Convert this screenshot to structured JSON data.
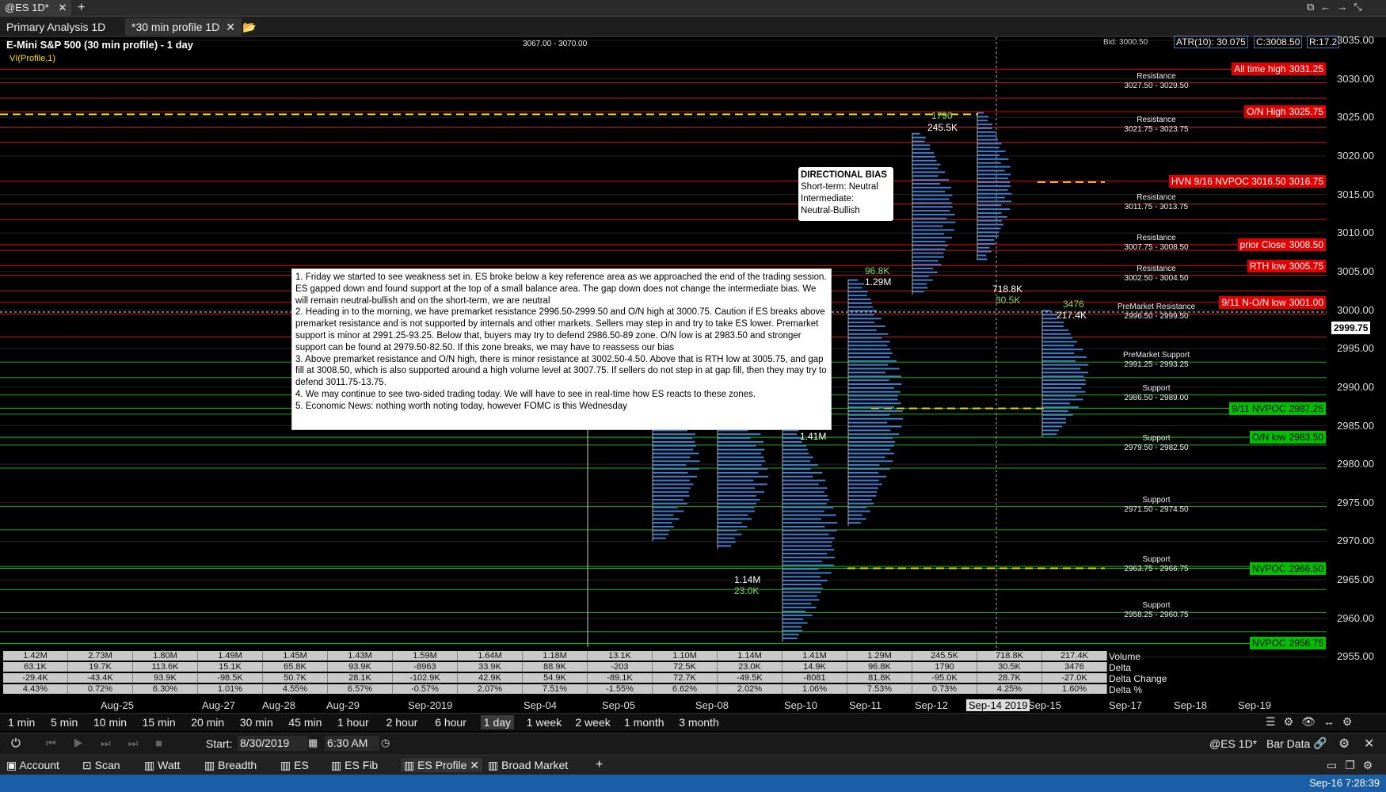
{
  "window_tabs": {
    "active": "@ES 1D*",
    "add": "+"
  },
  "chart_tabs": [
    {
      "label": "Primary Analysis 1D"
    },
    {
      "label": "*30 min profile 1D"
    }
  ],
  "chart": {
    "title": "E-Mini S&P 500 (30 min profile) - 1 day",
    "indicator": "VI(Profile,1)",
    "top_label": "3067.00 - 3070.00",
    "header_stats": {
      "atr": "ATR(10): 30.075",
      "close": "C:3008.50",
      "range": "R:17.2",
      "bid": "Bid: 3000.50"
    },
    "price_axis": [
      "3035.00",
      "3030.00",
      "3025.00",
      "3020.00",
      "3015.00",
      "3010.00",
      "3005.00",
      "3000.00",
      "2995.00",
      "2990.00",
      "2985.00",
      "2980.00",
      "2975.00",
      "2970.00",
      "2965.00",
      "2960.00",
      "2955.00"
    ],
    "current_price": "2999.75",
    "zones": [
      {
        "type": "Resistance",
        "range": "3027.50 - 3029.50"
      },
      {
        "type": "Resistance",
        "range": "3021.75 - 3023.75"
      },
      {
        "type": "Resistance",
        "range": "3011.75 - 3013.75"
      },
      {
        "type": "Resistance",
        "range": "3007.75 - 3008.50"
      },
      {
        "type": "Resistance",
        "range": "3002.50 - 3004.50"
      },
      {
        "type": "PreMarket Resistance",
        "range": "2996.50 - 2999.50"
      },
      {
        "type": "PreMarket Support",
        "range": "2991.25 - 2993.25"
      },
      {
        "type": "Support",
        "range": "2986.50 - 2989.00"
      },
      {
        "type": "Support",
        "range": "2979.50 - 2982.50"
      },
      {
        "type": "Support",
        "range": "2971.50 - 2974.50"
      },
      {
        "type": "Support",
        "range": "2963.75 - 2966.75"
      },
      {
        "type": "Support",
        "range": "2958.25 - 2960.75"
      }
    ],
    "tags": [
      {
        "label": "All time high",
        "price": "3031.25",
        "color": "red"
      },
      {
        "label": "O/N High",
        "price": "3025.75",
        "color": "red"
      },
      {
        "label": "HVN 9/16 NVPOC 3016.50",
        "price": "3016.75",
        "color": "red"
      },
      {
        "label": "prior Close",
        "price": "3008.50",
        "color": "red"
      },
      {
        "label": "RTH low",
        "price": "3005.75",
        "color": "red"
      },
      {
        "label": "9/11 N-O/N low",
        "price": "3001.00",
        "color": "red"
      },
      {
        "label": "9/11 NVPOC",
        "price": "2987.25",
        "color": "green"
      },
      {
        "label": "O/N low",
        "price": "2983.50",
        "color": "green"
      },
      {
        "label": "NVPOC",
        "price": "2966.50",
        "color": "green"
      },
      {
        "label": "NVPOC",
        "price": "2956.75",
        "color": "green"
      }
    ],
    "profile_labels": [
      {
        "vol": "1790",
        "vol2": "245.5K"
      },
      {
        "vol": "96.8K",
        "vol2": "1.29M"
      },
      {
        "vol": "718.8K",
        "vol2": "30.5K"
      },
      {
        "vol": "3476",
        "vol2": "217.4K"
      },
      {
        "vol": "1.14M",
        "vol2": "23.0K"
      },
      {
        "vol": "1.41M"
      }
    ],
    "bias": {
      "title": "DIRECTIONAL BIAS",
      "line1": "Short-term: Neutral",
      "line2": "Intermediate:",
      "line3": "Neutral-Bullish"
    },
    "notes": [
      "1. Friday we started to see weakness set in.  ES broke below a key reference area as we approached the end of the trading session.  ES gapped down and found support at the top of a small balance area.   The gap down does not change the intermediate bias.  We will remain neutral-bullish and on the short-term, we are neutral",
      "2. Heading in to the morning, we have premarket resistance 2996.50-2999.50 and O/N high at 3000.75.  Caution if ES breaks above premarket resistance and is not supported by internals and other markets.  Sellers may step in and try to take ES lower.  Premarket support is minor at 2991.25-93.25.  Below that, buyers may try to defend 2986.50-89 zone.  O/N low is at 2983.50 and stronger support can be found at 2979.50-82.50.  If this zone breaks, we may have to reassess our bias",
      "3. Above premarket resistance and O/N high, there is minor resistance at 3002.50-4.50.  Above that is RTH low at 3005.75, and gap fill at 3008.50, which is also supported around a high volume level at 3007.75.  If sellers do not step in at gap fill, then they may try to defend 3011.75-13.75.",
      "4. We may continue to see two-sided trading today.  We will have to see in real-time how ES reacts to these zones.",
      "5.  Economic News: nothing worth noting today, however FOMC is this Wednesday"
    ],
    "stats": {
      "labels": [
        "Volume",
        "Delta",
        "Delta Change",
        "Delta %"
      ],
      "volume": [
        "1.42M",
        "2.73M",
        "1.80M",
        "1.49M",
        "1.45M",
        "1.43M",
        "1.59M",
        "1.64M",
        "1.18M",
        "13.1K",
        "1.10M",
        "1.14M",
        "1.41M",
        "1.29M",
        "245.5K",
        "718.8K",
        "217.4K"
      ],
      "delta": [
        "63.1K",
        "19.7K",
        "113.6K",
        "15.1K",
        "65.8K",
        "93.9K",
        "-8963",
        "33.9K",
        "88.9K",
        "-203",
        "72.5K",
        "23.0K",
        "14.9K",
        "96.8K",
        "1790",
        "30.5K",
        "3476"
      ],
      "delta_change": [
        "-29.4K",
        "-43.4K",
        "93.9K",
        "-98.5K",
        "50.7K",
        "28.1K",
        "-102.9K",
        "42.9K",
        "54.9K",
        "-89.1K",
        "72.7K",
        "-49.5K",
        "-8081",
        "81.8K",
        "-95.0K",
        "28.7K",
        "-27.0K"
      ],
      "delta_pct": [
        "4.43%",
        "0.72%",
        "6.30%",
        "1.01%",
        "4.55%",
        "6.57%",
        "-0.57%",
        "2.07%",
        "7.51%",
        "-1.55%",
        "6.62%",
        "2.02%",
        "1.06%",
        "7.53%",
        "0.73%",
        "4.25%",
        "1.60%"
      ]
    },
    "dates": [
      "Aug-25",
      "Aug-27",
      "Aug-28",
      "Aug-29",
      "Sep-2019",
      "Sep-04",
      "Sep-05",
      "Sep-08",
      "Sep-10",
      "Sep-11",
      "Sep-12",
      "Sep-14 2019",
      "Sep-15",
      "Sep-17",
      "Sep-18",
      "Sep-19"
    ]
  },
  "timeframes": [
    "1 min",
    "5 min",
    "10 min",
    "15 min",
    "20 min",
    "30 min",
    "45 min",
    "1 hour",
    "2 hour",
    "6 hour",
    "1 day",
    "1 week",
    "2 week",
    "1 month",
    "3 month"
  ],
  "selected_timeframe": "1 day",
  "playback": {
    "start_label": "Start:",
    "start_date": "8/30/2019",
    "start_time": "6:30 AM",
    "symbol": "@ES 1D*",
    "data_type": "Bar Data"
  },
  "bottom_tabs": [
    "Account",
    "Scan",
    "Watt",
    "Breadth",
    "ES",
    "ES Fib",
    "ES Profile",
    "Broad Market"
  ],
  "status": {
    "datetime": "Sep-16 7:28:39"
  }
}
